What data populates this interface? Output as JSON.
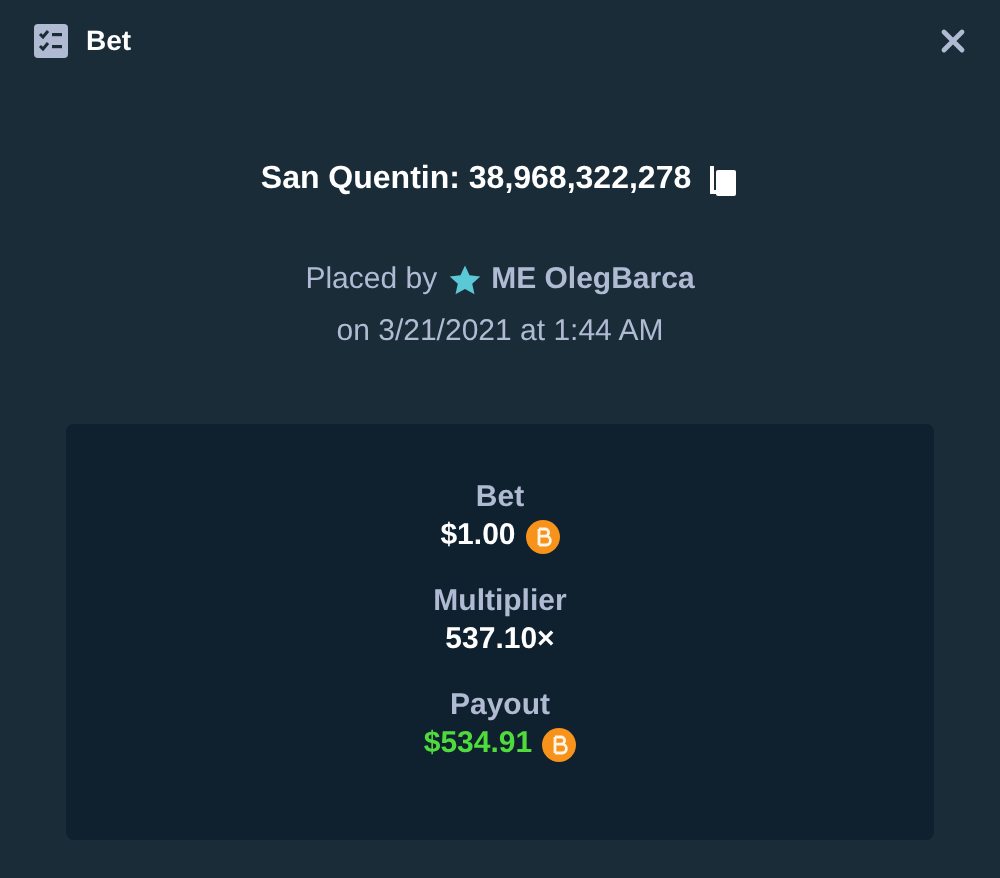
{
  "window": {
    "title": "Bet"
  },
  "game": {
    "title": "San Quentin: 38,968,322,278"
  },
  "placed_by": {
    "prefix": "Placed by",
    "user": "ME OlegBarca",
    "date": "on 3/21/2021 at 1:44 AM"
  },
  "stats": [
    {
      "kind": "amount",
      "label": "Bet",
      "value": "$1.00"
    },
    {
      "kind": "multiplier",
      "label": "Multiplier",
      "value": "537.10×"
    },
    {
      "kind": "payout",
      "label": "Payout",
      "value": "$534.91"
    }
  ]
}
